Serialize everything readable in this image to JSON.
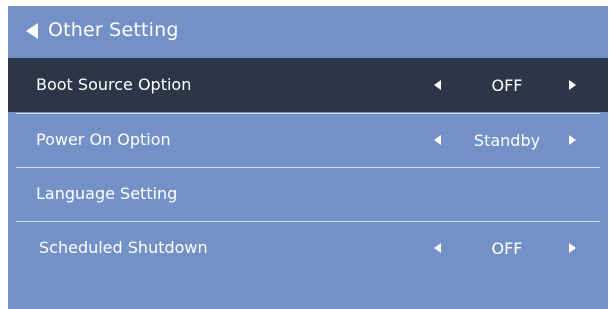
{
  "header": {
    "back_icon": "left-triangle-icon",
    "title": "Other Setting"
  },
  "rows": [
    {
      "label": "Boot Source Option",
      "value": "OFF",
      "selected": true
    },
    {
      "label": "Power On Option",
      "value": "Standby",
      "selected": false
    },
    {
      "label": "Language Setting",
      "value": "",
      "selected": false
    },
    {
      "label": "Scheduled Shutdown",
      "value": "OFF",
      "selected": false
    }
  ],
  "colors": {
    "panel_background": "#7391c7",
    "selected_row_background": "#2c3646",
    "text": "#ffffff",
    "divider": "#d6dff0"
  }
}
